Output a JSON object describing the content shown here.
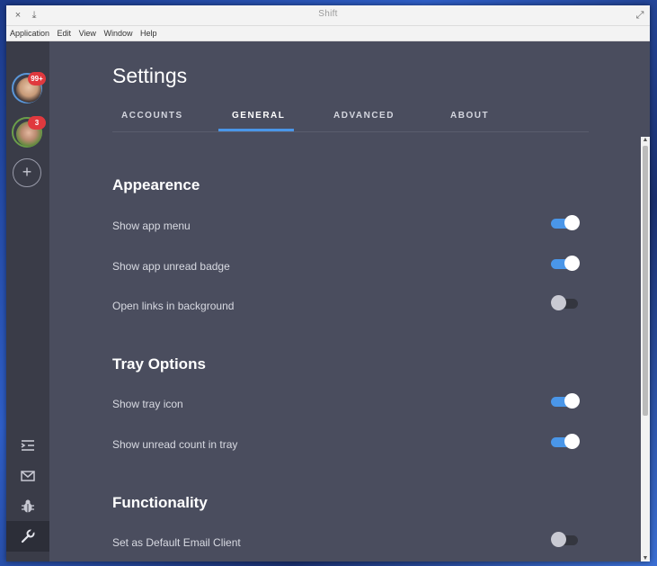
{
  "titlebar": {
    "title": "Shift",
    "close_glyph": "×",
    "download_glyph": "⤓",
    "maximize_glyph": "⤢"
  },
  "menubar": {
    "items": [
      "Application",
      "Edit",
      "View",
      "Window",
      "Help"
    ]
  },
  "sidebar": {
    "accounts": [
      {
        "badge": "99+",
        "color": "#5a96d8"
      },
      {
        "badge": "3",
        "color": "#6b9e4a"
      }
    ],
    "add_glyph": "+",
    "icons": [
      "list-indent-icon",
      "mail-icon",
      "bug-icon",
      "wrench-icon"
    ]
  },
  "settings": {
    "title": "Settings",
    "tabs": [
      "ACCOUNTS",
      "GENERAL",
      "ADVANCED",
      "ABOUT"
    ],
    "active_tab": "GENERAL",
    "sections": [
      {
        "title": "Appearence",
        "rows": [
          {
            "label": "Show app menu",
            "on": true
          },
          {
            "label": "Show app unread badge",
            "on": true
          },
          {
            "label": "Open links in background",
            "on": false
          }
        ]
      },
      {
        "title": "Tray Options",
        "rows": [
          {
            "label": "Show tray icon",
            "on": true
          },
          {
            "label": "Show unread count in tray",
            "on": true
          }
        ]
      },
      {
        "title": "Functionality",
        "rows": [
          {
            "label": "Set as Default Email Client",
            "on": false
          }
        ]
      }
    ]
  },
  "colors": {
    "accent": "#4a96e8",
    "badge": "#e0393e",
    "background": "#4a4d5e",
    "sidebar": "#3a3c48"
  }
}
